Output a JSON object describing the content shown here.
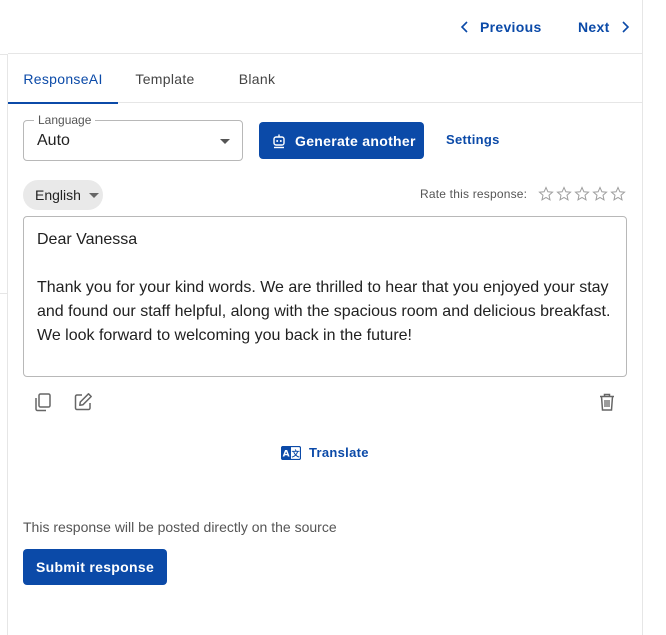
{
  "nav": {
    "previous_label": "Previous",
    "next_label": "Next"
  },
  "tabs": [
    {
      "label": "ResponseAI",
      "active": true
    },
    {
      "label": "Template",
      "active": false
    },
    {
      "label": "Blank",
      "active": false
    }
  ],
  "language": {
    "label": "Language",
    "value": "Auto"
  },
  "generate_button": {
    "label": "Generate another",
    "icon": "robot-icon"
  },
  "settings_label": "Settings",
  "output_language": "English",
  "rating": {
    "label": "Rate this response:",
    "max": 5,
    "value": 0
  },
  "response_text": "Dear Vanessa\n\nThank you for your kind words. We are thrilled to hear that you enjoyed your stay and found our staff helpful, along with the spacious room and delicious breakfast. We look forward to welcoming you back in the future!",
  "actions": {
    "copy_icon": "copy-icon",
    "edit_icon": "edit-icon",
    "delete_icon": "trash-icon"
  },
  "translate": {
    "label": "Translate",
    "icon": "translate-icon"
  },
  "note": "This response will be posted directly on the source",
  "submit_label": "Submit response",
  "colors": {
    "primary": "#0b4aa8",
    "chip_bg": "#e9e9e9",
    "border": "#b8b8b8"
  }
}
